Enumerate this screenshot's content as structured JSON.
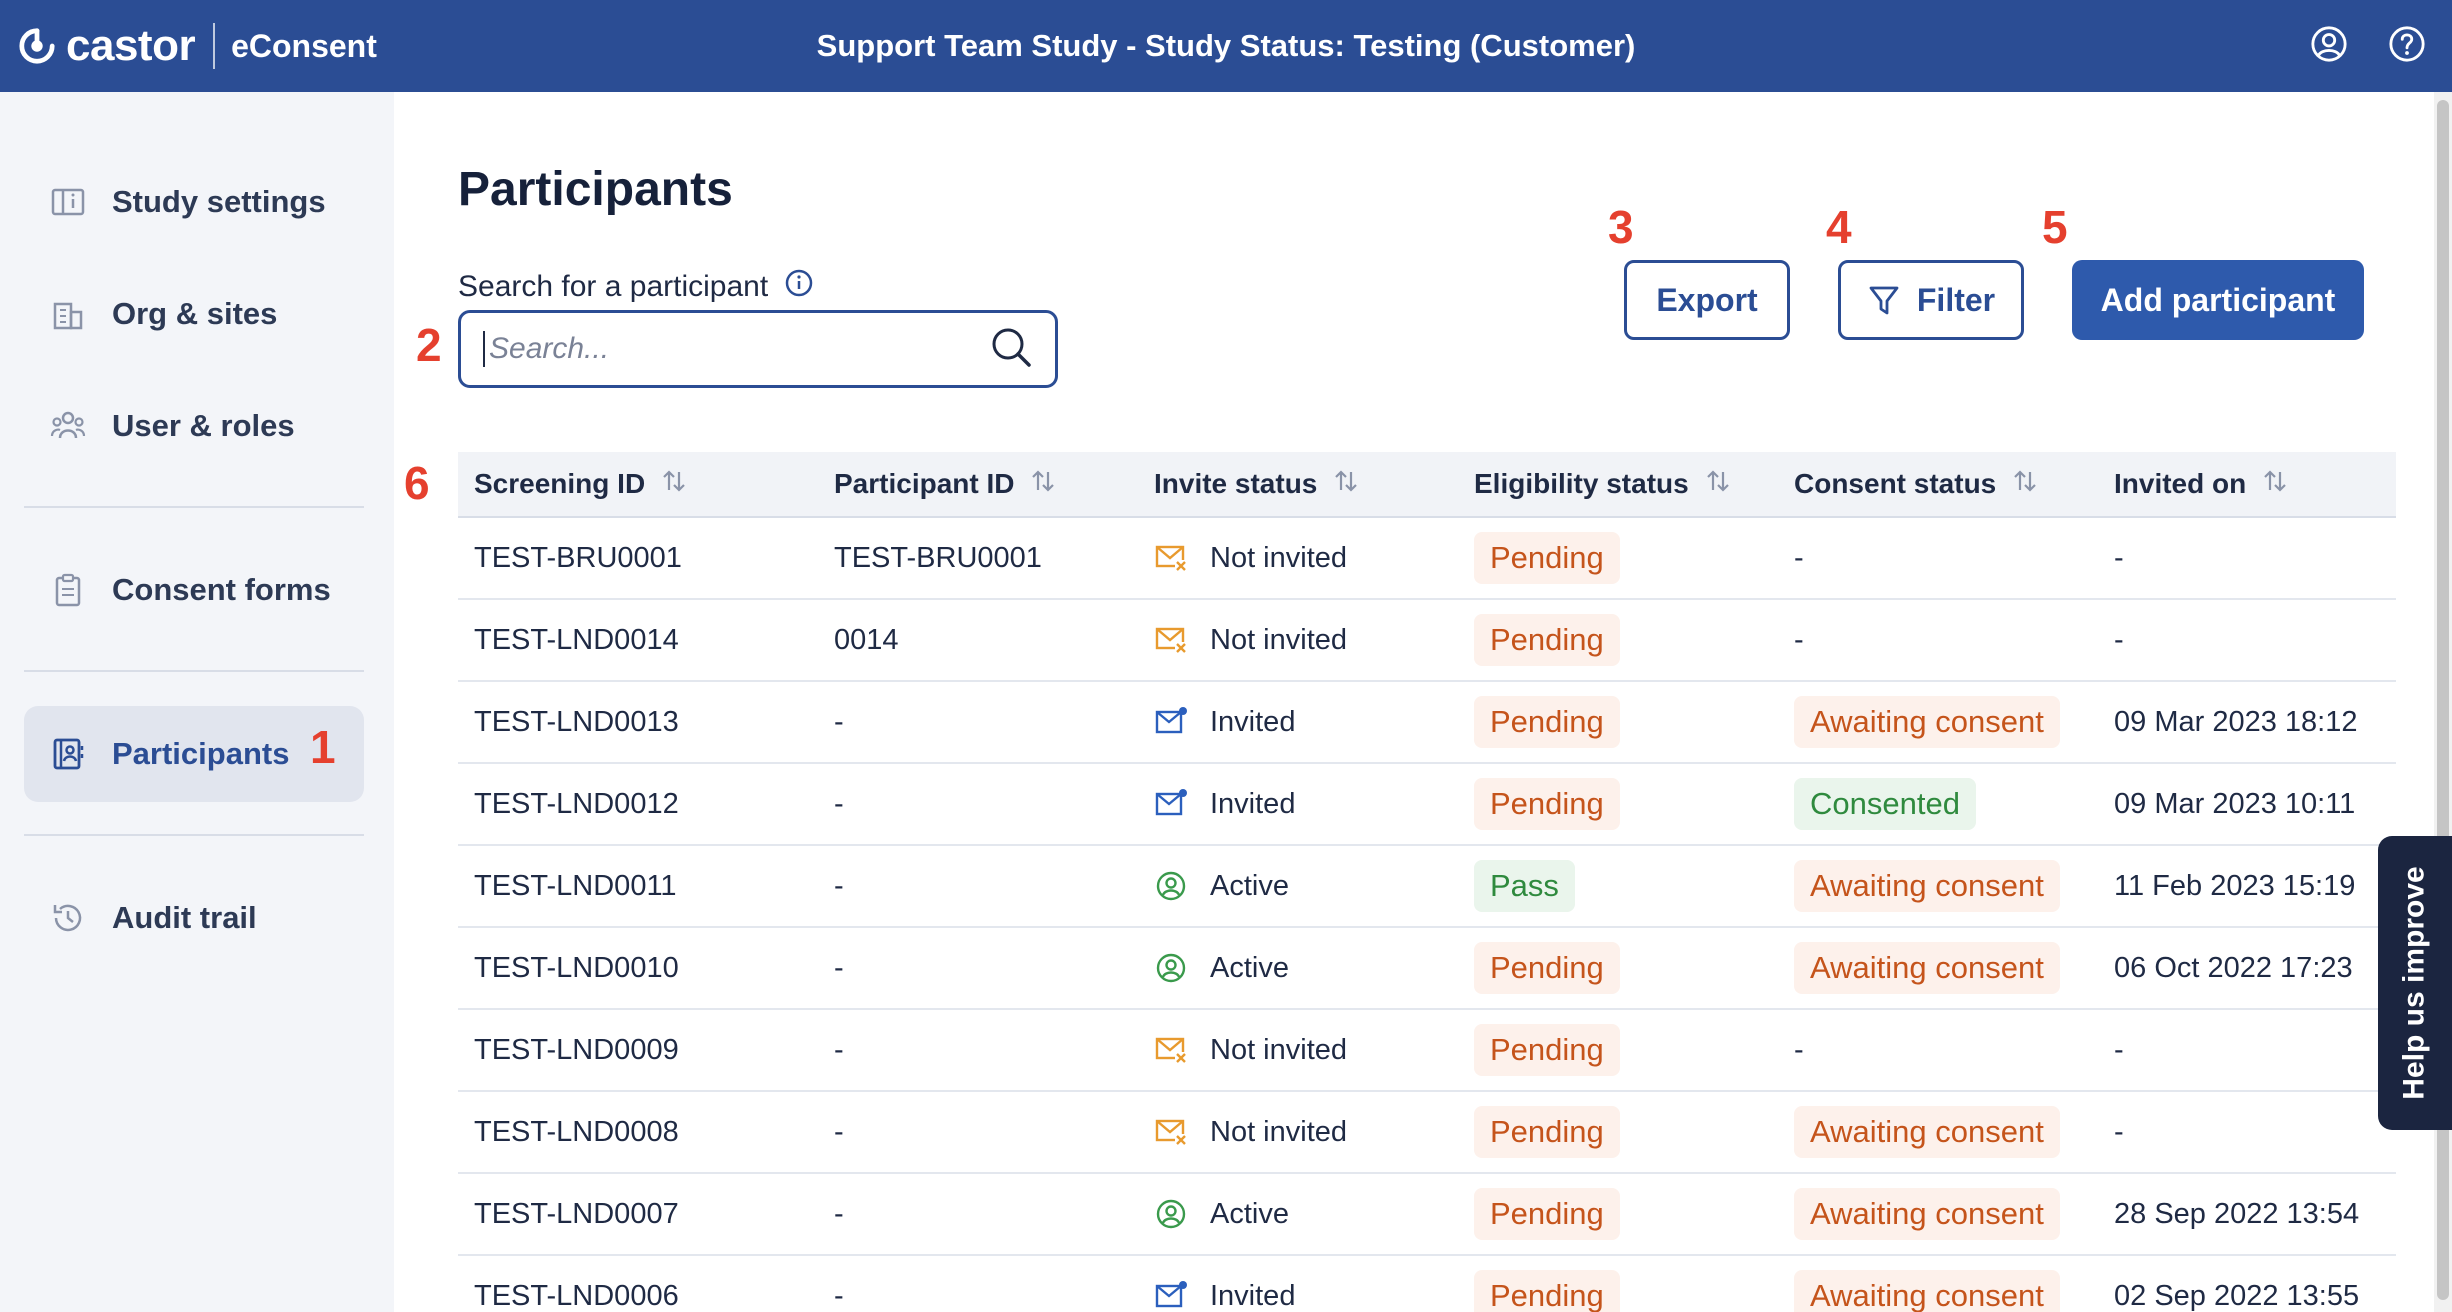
{
  "header": {
    "logo_text": "castor",
    "product": "eConsent",
    "title": "Support Team Study  - Study Status: Testing (Customer)",
    "icons": [
      "account-icon",
      "help-icon"
    ]
  },
  "sidebar": {
    "items": [
      {
        "label": "Study settings",
        "icon": "info-panel-icon"
      },
      {
        "label": "Org & sites",
        "icon": "building-icon"
      },
      {
        "label": "User & roles",
        "icon": "users-icon"
      },
      {
        "label": "Consent forms",
        "icon": "clipboard-icon"
      },
      {
        "label": "Participants",
        "icon": "contacts-icon",
        "active": true
      },
      {
        "label": "Audit trail",
        "icon": "history-icon"
      }
    ]
  },
  "annotations": [
    "1",
    "2",
    "3",
    "4",
    "5",
    "6"
  ],
  "main": {
    "title": "Participants",
    "search_label": "Search for a participant",
    "search_placeholder": "Search...",
    "export_label": "Export",
    "filter_label": "Filter",
    "add_label": "Add participant"
  },
  "table": {
    "columns": [
      "Screening ID",
      "Participant ID",
      "Invite status",
      "Eligibility status",
      "Consent status",
      "Invited on"
    ],
    "rows": [
      {
        "screening": "TEST-BRU0001",
        "participant": "TEST-BRU0001",
        "invite": "Not invited",
        "eligibility": "Pending",
        "consent": "-",
        "invited_on": "-"
      },
      {
        "screening": "TEST-LND0014",
        "participant": "0014",
        "invite": "Not invited",
        "eligibility": "Pending",
        "consent": "-",
        "invited_on": "-"
      },
      {
        "screening": "TEST-LND0013",
        "participant": "-",
        "invite": "Invited",
        "eligibility": "Pending",
        "consent": "Awaiting consent",
        "invited_on": "09 Mar 2023 18:12"
      },
      {
        "screening": "TEST-LND0012",
        "participant": "-",
        "invite": "Invited",
        "eligibility": "Pending",
        "consent": "Consented",
        "invited_on": "09 Mar 2023 10:11"
      },
      {
        "screening": "TEST-LND0011",
        "participant": "-",
        "invite": "Active",
        "eligibility": "Pass",
        "consent": "Awaiting consent",
        "invited_on": "11 Feb 2023 15:19"
      },
      {
        "screening": "TEST-LND0010",
        "participant": "-",
        "invite": "Active",
        "eligibility": "Pending",
        "consent": "Awaiting consent",
        "invited_on": "06 Oct 2022 17:23"
      },
      {
        "screening": "TEST-LND0009",
        "participant": "-",
        "invite": "Not invited",
        "eligibility": "Pending",
        "consent": "-",
        "invited_on": "-"
      },
      {
        "screening": "TEST-LND0008",
        "participant": "-",
        "invite": "Not invited",
        "eligibility": "Pending",
        "consent": "Awaiting consent",
        "invited_on": "-"
      },
      {
        "screening": "TEST-LND0007",
        "participant": "-",
        "invite": "Active",
        "eligibility": "Pending",
        "consent": "Awaiting consent",
        "invited_on": "28 Sep 2022 13:54"
      },
      {
        "screening": "TEST-LND0006",
        "participant": "-",
        "invite": "Invited",
        "eligibility": "Pending",
        "consent": "Awaiting consent",
        "invited_on": "02 Sep 2022 13:55"
      }
    ]
  },
  "feedback_tab": "Help us improve",
  "colors": {
    "brand": "#2b4d94",
    "pending": "#c5541b",
    "pass": "#2f8a3e",
    "annotation": "#e5402e"
  }
}
